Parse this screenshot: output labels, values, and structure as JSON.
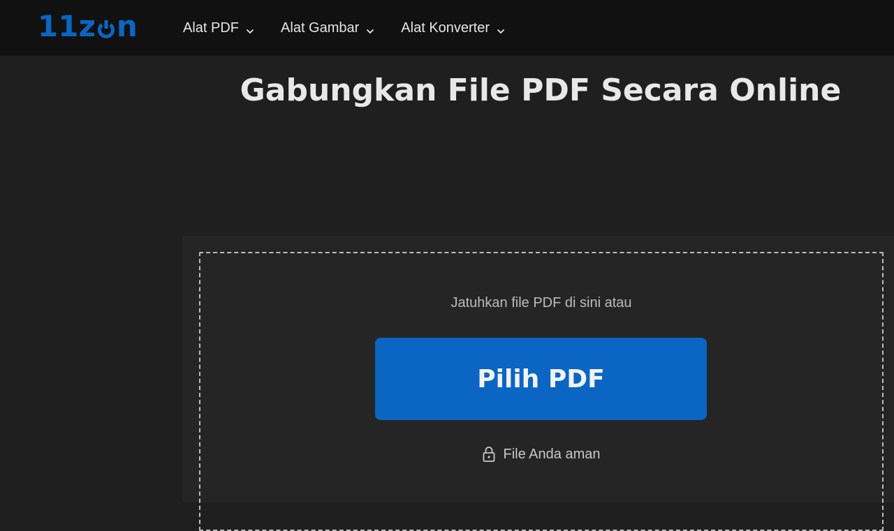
{
  "logo": {
    "text_prefix": "11z",
    "text_suffix": "n",
    "color": "#0a66c2"
  },
  "nav": {
    "items": [
      {
        "label": "Alat PDF"
      },
      {
        "label": "Alat Gambar"
      },
      {
        "label": "Alat Konverter"
      }
    ]
  },
  "page": {
    "title": "Gabungkan File PDF Secara Online"
  },
  "upload": {
    "drop_text": "Jatuhkan file PDF di sini atau",
    "button_label": "Pilih PDF",
    "secure_text": "File Anda aman"
  },
  "colors": {
    "accent": "#0a66c2",
    "background": "#1f1f1f",
    "topbar": "#111111",
    "panel": "#252525"
  }
}
